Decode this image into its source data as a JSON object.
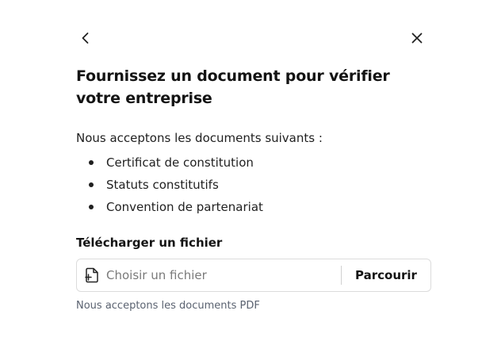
{
  "dialog": {
    "back_icon": "chevron-left-icon",
    "close_icon": "close-icon",
    "title": "Fournissez un document pour vérifier votre entreprise",
    "intro": "Nous acceptons les documents suivants :",
    "documents": [
      "Certificat de constitution",
      "Statuts constitutifs",
      "Convention de partenariat"
    ],
    "upload": {
      "label": "Télécharger un fichier",
      "icon": "file-plus-icon",
      "placeholder": "Choisir un fichier",
      "browse_label": "Parcourir",
      "hint": "Nous acceptons les documents PDF"
    }
  }
}
